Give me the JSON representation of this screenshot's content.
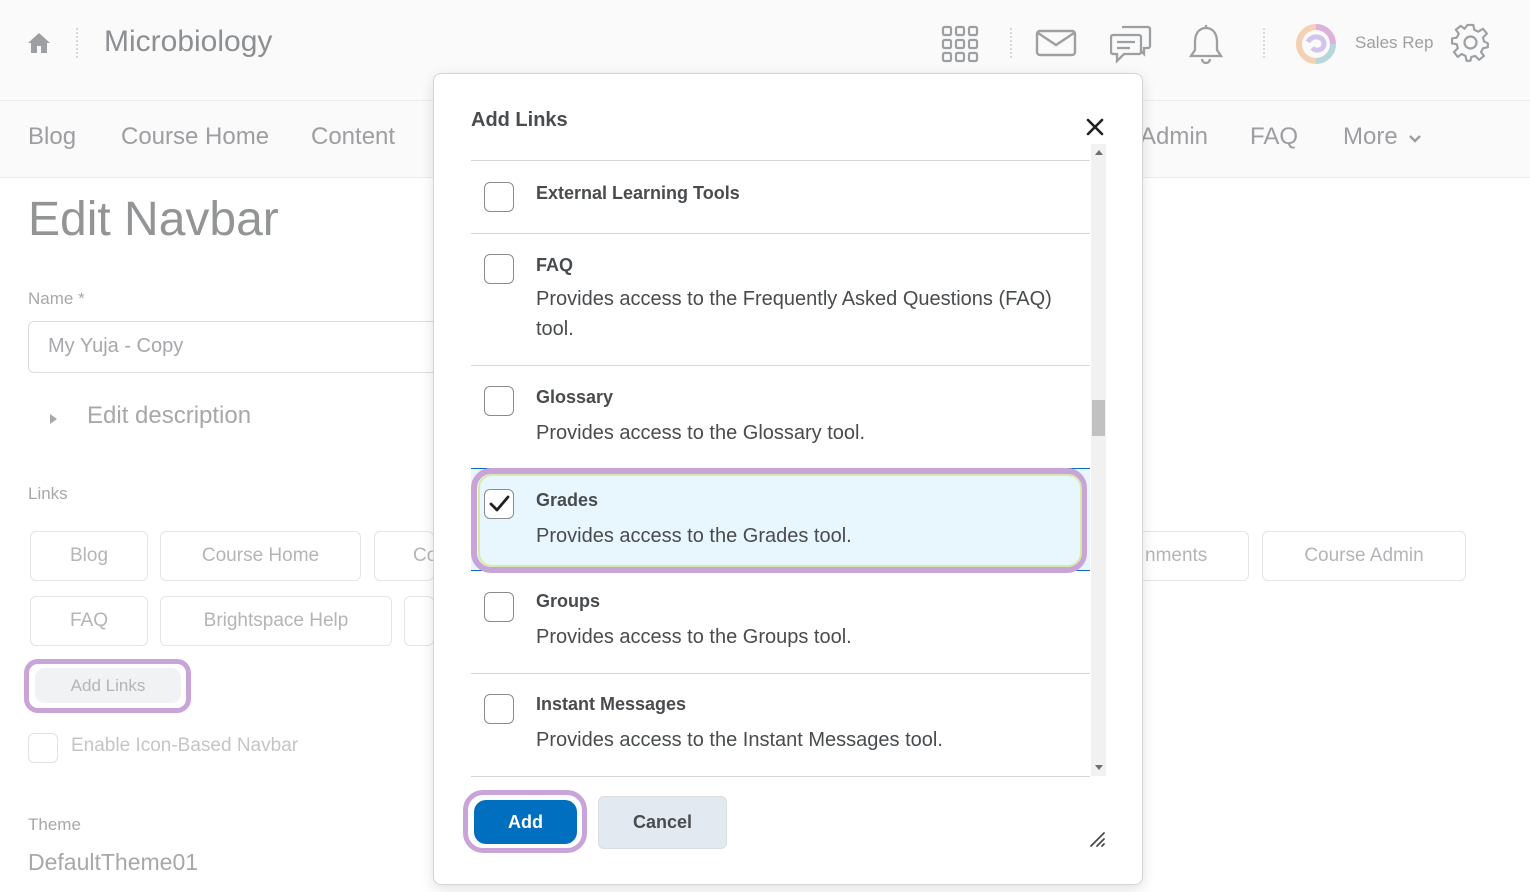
{
  "header": {
    "course_title": "Microbiology",
    "user_name": "Sales Rep"
  },
  "navbar": {
    "items": [
      "Blog",
      "Course Home",
      "Content",
      "Admin",
      "FAQ",
      "More"
    ]
  },
  "page": {
    "title": "Edit Navbar",
    "name_label": "Name *",
    "name_value": "My Yuja - Copy",
    "edit_description": "Edit description",
    "links_label": "Links",
    "link_chips": [
      "Blog",
      "Course Home",
      "Co",
      "nments",
      "Course Admin",
      "FAQ",
      "Brightspace Help"
    ],
    "add_links_button": "Add Links",
    "icon_navbar_label": "Enable Icon-Based Navbar",
    "theme_label": "Theme",
    "theme_value": "DefaultTheme01"
  },
  "dialog": {
    "title": "Add Links",
    "items": [
      {
        "name": "External Learning Tools",
        "description": "",
        "checked": false
      },
      {
        "name": "FAQ",
        "description": "Provides access to the Frequently Asked Questions (FAQ) tool.",
        "checked": false
      },
      {
        "name": "Glossary",
        "description": "Provides access to the Glossary tool.",
        "checked": false
      },
      {
        "name": "Grades",
        "description": "Provides access to the Grades tool.",
        "checked": true
      },
      {
        "name": "Groups",
        "description": "Provides access to the Groups tool.",
        "checked": false
      },
      {
        "name": "Instant Messages",
        "description": "Provides access to the Instant Messages tool.",
        "checked": false
      }
    ],
    "add_button": "Add",
    "cancel_button": "Cancel"
  },
  "colors": {
    "primary": "#006fbf",
    "highlight_outline": "#c8a4d8",
    "selected_row": "#e8f6fd"
  },
  "icons": [
    "home-icon",
    "waffle-icon",
    "mail-icon",
    "chat-icon",
    "bell-icon",
    "avatar",
    "gear-icon",
    "close-icon",
    "checkmark-icon",
    "chevron-down-icon",
    "resize-icon"
  ]
}
